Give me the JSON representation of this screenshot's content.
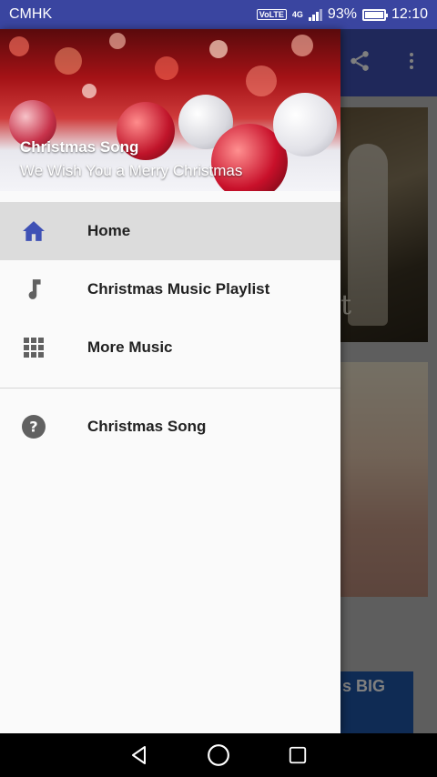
{
  "status_bar": {
    "carrier": "CMHK",
    "volte": "VoLTE",
    "network": "4G",
    "battery": "93%",
    "battery_level": 0.93,
    "time": "12:10"
  },
  "drawer": {
    "header": {
      "title": "Christmas Song",
      "subtitle": "We Wish You a Merry Christmas"
    },
    "items": [
      {
        "label": "Home",
        "icon": "home-icon",
        "active": true
      },
      {
        "label": "Christmas Music Playlist",
        "icon": "music-note-icon",
        "active": false
      },
      {
        "label": "More Music",
        "icon": "grid-icon",
        "active": false
      }
    ],
    "secondary_items": [
      {
        "label": "Christmas Song",
        "icon": "help-icon"
      }
    ]
  },
  "background_app": {
    "toolbar_icons": [
      "share-icon",
      "more-vert-icon"
    ],
    "ad_text": "s BIG"
  },
  "colors": {
    "primary": "#3f51b5",
    "active_icon": "#3f51b5",
    "status_bar": "#3a45a0"
  }
}
